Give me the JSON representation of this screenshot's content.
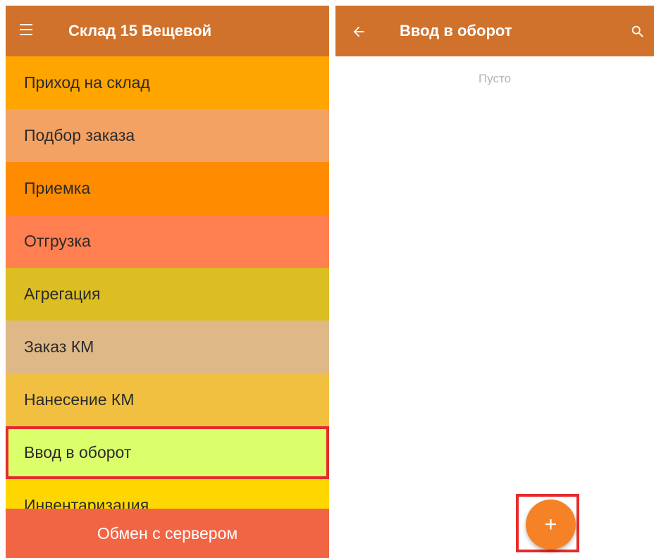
{
  "left_screen": {
    "appbar": {
      "title": "Склад 15 Вещевой",
      "menu_icon": "hamburger-icon"
    },
    "menu": {
      "items": [
        {
          "label": "Приход на склад",
          "color": "#FFA500"
        },
        {
          "label": "Подбор заказа",
          "color": "#F4A264"
        },
        {
          "label": "Приемка",
          "color": "#FF8C00"
        },
        {
          "label": "Отгрузка",
          "color": "#FF7F50"
        },
        {
          "label": "Агрегация",
          "color": "#DCBE22"
        },
        {
          "label": "Заказ КМ",
          "color": "#DEB887"
        },
        {
          "label": "Нанесение КМ",
          "color": "#F2C040"
        },
        {
          "label": "Ввод в оборот",
          "color": "#DAFF6A",
          "selected": true
        },
        {
          "label": "Инвентаризация",
          "color": "#FFD700"
        }
      ]
    },
    "footer_button": {
      "label": "Обмен с сервером",
      "color": "#F26544"
    }
  },
  "right_screen": {
    "appbar": {
      "title": "Ввод в оборот",
      "back_icon": "arrow-back-icon",
      "search_icon": "search-icon"
    },
    "empty_text": "Пусто",
    "fab": {
      "label": "+",
      "color": "#F58226"
    }
  },
  "colors": {
    "appbar": "#D0722C",
    "highlight": "#E52B2B"
  }
}
